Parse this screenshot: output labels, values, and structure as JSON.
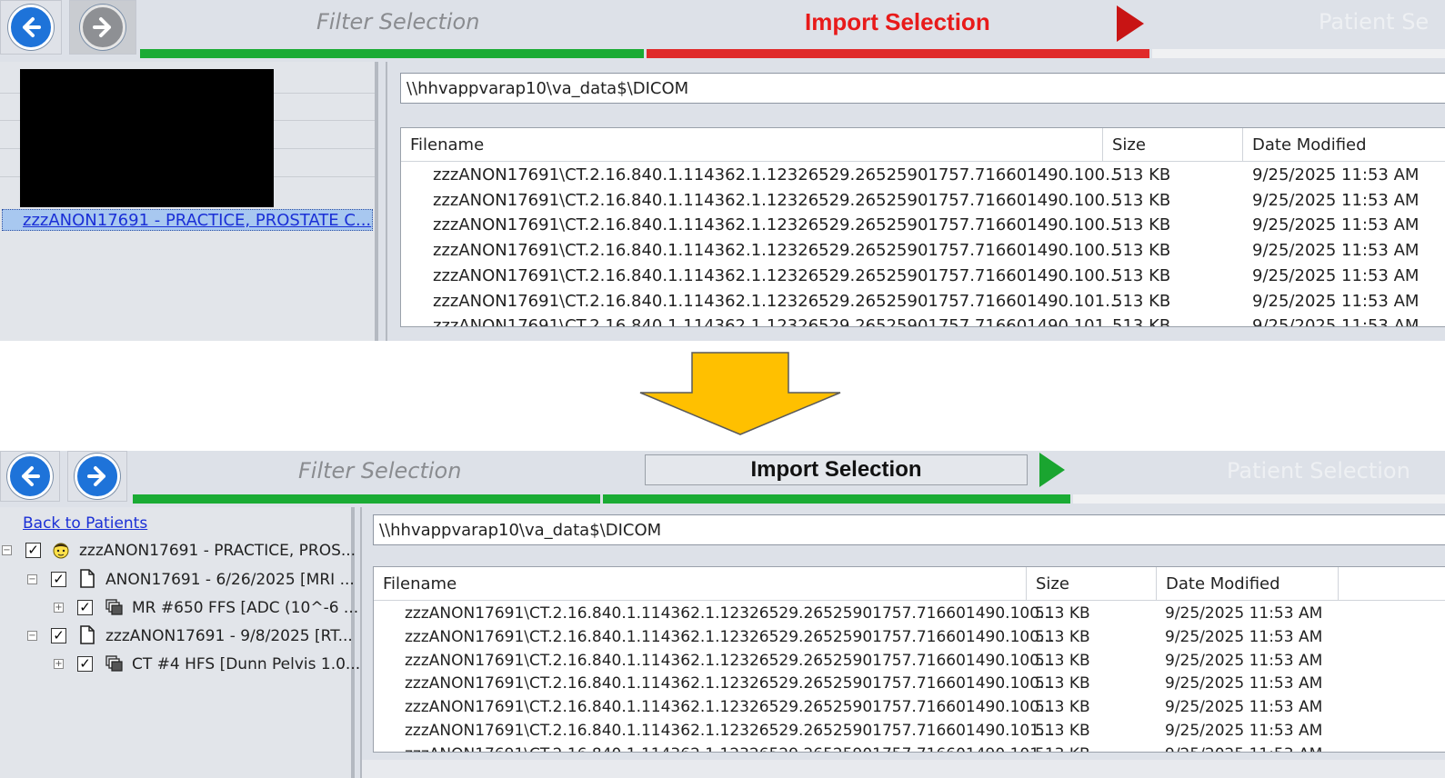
{
  "before": {
    "steps": {
      "filter": "Filter Selection",
      "import": "Import Selection",
      "patient": "Patient Se"
    },
    "patient_item": "zzzANON17691 - PRACTICE, PROSTATE  C...",
    "path": "\\\\hhvappvarap10\\va_data$\\DICOM",
    "columns": {
      "filename": "Filename",
      "size": "Size",
      "date": "Date Modified"
    },
    "rows": [
      {
        "filename": "zzzANON17691\\CT.2.16.840.1.114362.1.12326529.26525901757.716601490.100...",
        "size": "513 KB",
        "date": "9/25/2025 11:53 AM"
      },
      {
        "filename": "zzzANON17691\\CT.2.16.840.1.114362.1.12326529.26525901757.716601490.100...",
        "size": "513 KB",
        "date": "9/25/2025 11:53 AM"
      },
      {
        "filename": "zzzANON17691\\CT.2.16.840.1.114362.1.12326529.26525901757.716601490.100...",
        "size": "513 KB",
        "date": "9/25/2025 11:53 AM"
      },
      {
        "filename": "zzzANON17691\\CT.2.16.840.1.114362.1.12326529.26525901757.716601490.100...",
        "size": "513 KB",
        "date": "9/25/2025 11:53 AM"
      },
      {
        "filename": "zzzANON17691\\CT.2.16.840.1.114362.1.12326529.26525901757.716601490.100...",
        "size": "513 KB",
        "date": "9/25/2025 11:53 AM"
      },
      {
        "filename": "zzzANON17691\\CT.2.16.840.1.114362.1.12326529.26525901757.716601490.101...",
        "size": "513 KB",
        "date": "9/25/2025 11:53 AM"
      },
      {
        "filename": "zzzANON17691\\CT.2.16.840.1.114362.1.12326529.26525901757.716601490.101...",
        "size": "513 KB",
        "date": "9/25/2025 11:53 AM"
      }
    ]
  },
  "after": {
    "steps": {
      "filter": "Filter Selection",
      "import": "Import Selection",
      "patient": "Patient Selection"
    },
    "back_link": "Back to Patients",
    "tree": [
      {
        "label": "zzzANON17691 - PRACTICE, PROS...",
        "icon": "patient-face-icon",
        "expander": "−",
        "checked": "✓"
      },
      {
        "label": "ANON17691 - 6/26/2025 [MRI ...",
        "icon": "document-icon",
        "expander": "−",
        "checked": "✓"
      },
      {
        "label": "MR #650 FFS [ADC (10^-6 ...",
        "icon": "image-series-icon",
        "expander": "+",
        "checked": "✓"
      },
      {
        "label": "zzzANON17691 - 9/8/2025 [RT...",
        "icon": "document-icon",
        "expander": "−",
        "checked": "✓"
      },
      {
        "label": "CT #4 HFS [Dunn Pelvis 1.0...",
        "icon": "image-series-icon",
        "expander": "+",
        "checked": "✓"
      }
    ],
    "path": "\\\\hhvappvarap10\\va_data$\\DICOM",
    "columns": {
      "filename": "Filename",
      "size": "Size",
      "date": "Date Modified"
    },
    "rows": [
      {
        "filename": "zzzANON17691\\CT.2.16.840.1.114362.1.12326529.26525901757.716601490.100...",
        "size": "513 KB",
        "date": "9/25/2025 11:53 AM"
      },
      {
        "filename": "zzzANON17691\\CT.2.16.840.1.114362.1.12326529.26525901757.716601490.100...",
        "size": "513 KB",
        "date": "9/25/2025 11:53 AM"
      },
      {
        "filename": "zzzANON17691\\CT.2.16.840.1.114362.1.12326529.26525901757.716601490.100...",
        "size": "513 KB",
        "date": "9/25/2025 11:53 AM"
      },
      {
        "filename": "zzzANON17691\\CT.2.16.840.1.114362.1.12326529.26525901757.716601490.100...",
        "size": "513 KB",
        "date": "9/25/2025 11:53 AM"
      },
      {
        "filename": "zzzANON17691\\CT.2.16.840.1.114362.1.12326529.26525901757.716601490.100...",
        "size": "513 KB",
        "date": "9/25/2025 11:53 AM"
      },
      {
        "filename": "zzzANON17691\\CT.2.16.840.1.114362.1.12326529.26525901757.716601490.101...",
        "size": "513 KB",
        "date": "9/25/2025 11:53 AM"
      },
      {
        "filename": "zzzANON17691\\CT.2.16.840.1.114362.1.12326529.26525901757.716601490.101...",
        "size": "513 KB",
        "date": "9/25/2025 11:53 AM"
      }
    ]
  },
  "colors": {
    "progress_green": "#1aab34",
    "progress_red": "#e02a2a",
    "arrow_fill": "#ffc000",
    "play_red": "#c81414",
    "play_green": "#1aa530",
    "link_blue": "#1a2fd6",
    "selection_blue": "#a8c8f0"
  }
}
